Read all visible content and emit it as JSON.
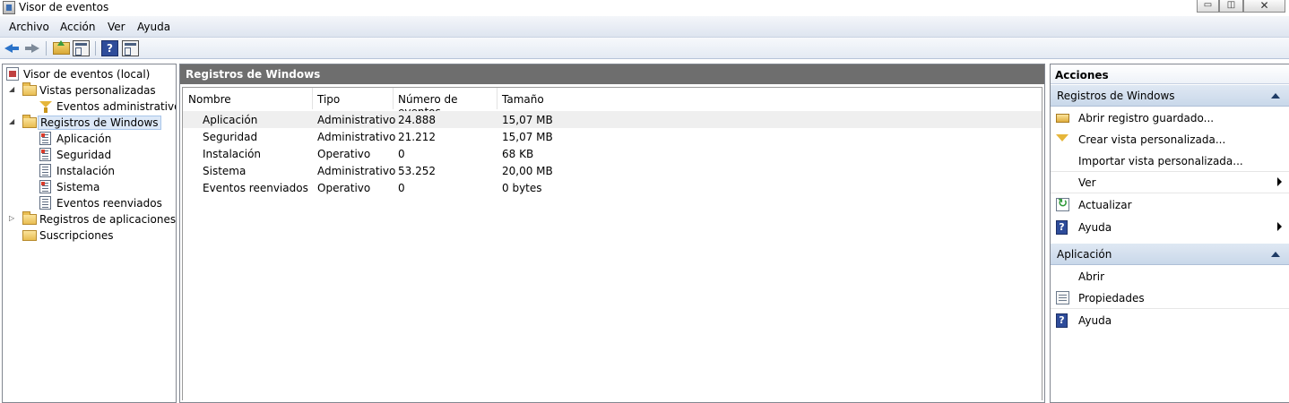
{
  "window": {
    "title": "Visor de eventos",
    "controls": {
      "minimize": "▭",
      "maximize": "◫",
      "close": "✕"
    }
  },
  "menu": [
    "Archivo",
    "Acción",
    "Ver",
    "Ayuda"
  ],
  "toolbar": {
    "icons": [
      "back-arrow-icon",
      "forward-arrow-icon",
      "up-folder-icon",
      "show-hide-console-tree-icon",
      "help-icon",
      "show-hide-action-pane-icon"
    ],
    "help_glyph": "?"
  },
  "tree": {
    "root": "Visor de eventos (local)",
    "custom_views": "Vistas personalizadas",
    "admin_events": "Eventos administrativos",
    "windows_logs": "Registros de Windows",
    "logs": [
      "Aplicación",
      "Seguridad",
      "Instalación",
      "Sistema",
      "Eventos reenviados"
    ],
    "app_service_logs": "Registros de aplicaciones y s",
    "subscriptions": "Suscripciones",
    "expanders": {
      "expanded": "◢",
      "collapsed": "▷"
    }
  },
  "center": {
    "header": "Registros de Windows",
    "columns": [
      "Nombre",
      "Tipo",
      "Número de eventos",
      "Tamaño"
    ],
    "rows": [
      {
        "name": "Aplicación",
        "type": "Administrativo",
        "events": "24.888",
        "size": "15,07 MB"
      },
      {
        "name": "Seguridad",
        "type": "Administrativo",
        "events": "21.212",
        "size": "15,07 MB"
      },
      {
        "name": "Instalación",
        "type": "Operativo",
        "events": "0",
        "size": "68 KB"
      },
      {
        "name": "Sistema",
        "type": "Administrativo",
        "events": "53.252",
        "size": "20,00 MB"
      },
      {
        "name": "Eventos reenviados",
        "type": "Operativo",
        "events": "0",
        "size": "0 bytes"
      }
    ]
  },
  "actions": {
    "title": "Acciones",
    "section1": {
      "title": "Registros de Windows",
      "items": [
        "Abrir registro guardado...",
        "Crear vista personalizada...",
        "Importar vista personalizada...",
        "Ver",
        "Actualizar",
        "Ayuda"
      ]
    },
    "section2": {
      "title": "Aplicación",
      "items": [
        "Abrir",
        "Propiedades",
        "Ayuda"
      ]
    },
    "help_glyph": "?"
  }
}
